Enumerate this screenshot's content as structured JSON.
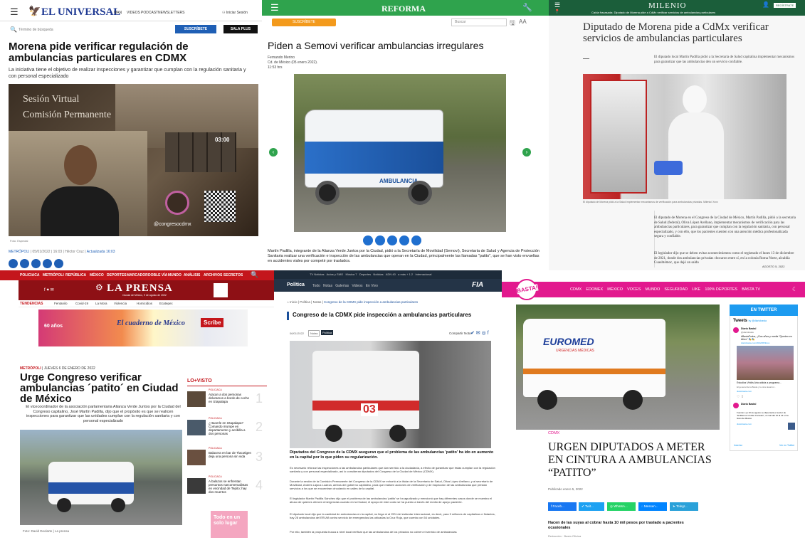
{
  "p1": {
    "logo": "EL UNIVERSAL",
    "nav": [
      "MAN",
      "VIDEOS",
      "PODCAST",
      "NEWSLETTERS"
    ],
    "login": "Iniciar Sesión",
    "search_placeholder": "Término de búsqueda",
    "subscribe": "SUSCRÍBETE",
    "sala": "SALA PLUS",
    "headline": "Morena pide verificar regulación de ambulancias particulares en CDMX",
    "subhead": "La iniciativa tiene el objetivo de realizar inspecciones y garantizar que cumplan con la regulación sanitaria y con personal especializado",
    "video_title1": "Sesión Virtual",
    "video_title2": "Comisión Permanente",
    "timer": "03:00",
    "handle": "@congresocdmx",
    "credit": "Foto: Especial",
    "meta_section": "METRÓPOLI",
    "meta_date": "05/01/2022",
    "meta_time": "16:03",
    "meta_author": "Héctor Cruz",
    "meta_updated": "Actualizada 16:03"
  },
  "p2": {
    "logo": "REFORMA",
    "subscribe": "SUSCRÍBETE",
    "search_placeholder": "Buscar",
    "headline": "Piden a Semovi verificar ambulancias irregulares",
    "author": "Fernando Merino",
    "dateline": "Cd. de México (05 enero 2022).",
    "time": "11:53 hrs",
    "ambulance_text": "AMBULANCIA",
    "body": "Martín Padilla, integrante de la Alianza Verde Juntos por la Ciudad, pidió a la Secretaría de Movilidad (Semovi), Secretaría de Salud y Agencia de Protección Sanitaria realizar una verificación e inspección de las ambulancias que operan en la Ciudad, principalmente las llamadas \"patito\", que se han visto envueltas en accidentes viales por competir por traslados."
  },
  "p3": {
    "logo": "MILENIO",
    "ticker": "Caída fracasada: Diputado de Morena pide a CdMx verificar servicios de ambulancias particulares",
    "subscribe": "REGÍSTRATE",
    "headline": "Diputado de Morena pide a CdMx verificar servicios de ambulancias particulares",
    "lede": "El diputado local Martín Padilla pidió a la Secretaría de Salud capitalina implementar mecanismos para garantizar que las ambulancias den un servicio confiable.",
    "caption": "El diputado de Morena pidió a la Salud implementar mecanismos de verificación para ambulancias privadas. Milenio/ Xxxx",
    "p1": "El diputado de Morena en el Congreso de la Ciudad de México, Martín Padilla, pidió a la secretaria de Salud (federal), Oliva López Arellano, implementar mecanismos de verificación para las ambulancias particulares, para garantizar que cumplan con la regulación sanitaria, con personal especializado, y con ello, que los pacientes cuenten con una atención médica profesionalizada segura y confiable.",
    "p2": "El legislador dijo que se deben evitar acontecimientos como el registrado el lunes 13 de diciembre de 2021, donde dos ambulancias privadas chocaron entre sí, en la colonia Roma Norte, alcaldía Cuauhtémoc, que dejó un saldo",
    "date": "AGOSTO 5, 2022"
  },
  "p4": {
    "nav": [
      "POLICIACA",
      "METRÓPOLI",
      "REPÚBLICA",
      "MÉXICO",
      "DEPORTES",
      "MARCADOR",
      "DOBLE VÍA",
      "MUNDO",
      "ANÁLISIS",
      "ARCHIVOS SECRETOS"
    ],
    "logo": "LA PRENSA",
    "logo_sub": "Ciudad de México, 9 de agosto de 2022",
    "trending_label": "TENDENCIAS",
    "trending": [
      "Fentanilo",
      "Covid-19",
      "La Mora",
      "Violencia",
      "Homicidios",
      "Ecatepec"
    ],
    "ad_text": "El cuaderno de México",
    "ad_years": "60 años",
    "ad_brand": "Scribe",
    "section": "METRÓPOLI",
    "date": "JUEVES 6 DE ENERO DE 2022",
    "headline": "Urge Congreso verificar ambulancias ´patito´ en Ciudad de México",
    "subhead": "El vicecoordinador de la asociación parlamentaria Alianza Verde Juntos por la Ciudad del Congreso capitalino, José Martín Padilla, dijo que el propósito es que se realicen inspecciones para garantizar que las unidades cumplan con la regulación sanitaria y con personal especializado",
    "credit": "Foto: David Deolarte | La prensa",
    "lovisto_title": "LO+VISTO",
    "lovisto": [
      {
        "tag": "POLICIACA",
        "text": "Atacan a dos personas deluramos a bordo de coche en Iztapalapa",
        "num": "1"
      },
      {
        "tag": "POLICIACA",
        "text": "¿Hacerle en Iztapalapa? Comando irrumpe en departamento y acribilla a dos personas",
        "num": "2"
      },
      {
        "tag": "POLICIACA",
        "text": "Balacera en bar de Tlacotlgen deja una persona sin vida",
        "num": "3"
      },
      {
        "tag": "POLICIACA",
        "text": "A balazos se enfrentan presuntos narcomenudistas en vecindad de Tepito; hay dos muertos",
        "num": "4"
      }
    ],
    "sidebar_ad": "Todo en un solo lugar"
  },
  "p5": {
    "nav": [
      "TV Noticias",
      "Autos y SMO",
      "Música 7",
      "Deportes",
      "Noticias",
      "ADN 40",
      "a más + 1.2",
      "Internacional"
    ],
    "section": "Política",
    "tabs": [
      "Todo",
      "Notas",
      "Galerías",
      "Videos",
      "En Vivo"
    ],
    "brand": "FIA",
    "breadcrumb": [
      "Inicio",
      "Política",
      "Notas",
      "Congreso de la CDMX pide inspección a ambulancias particulares"
    ],
    "headline": "Congreso de la CDMX pide inspección a ambulancias particulares",
    "date_meta": "06/01/2022",
    "tags": [
      "Notas",
      "Política"
    ],
    "share": "Compartir Nota",
    "ambulance_number": "03",
    "lede": "Diputados del Congreso de la CDMX aseguran que el problema de las ambulancias 'patito' ha ido en aumento en la capital por lo que piden su regularización.",
    "p1": "Es necesario reforzar las inspecciones a las ambulancias particulares que dan servicio a la ciudadanía, a efecto de garantizar que éstas cumplan con la regulación sanitaria y con personal especializado, así lo consideran diputados del Congreso de la Ciudad de México (CDMX).",
    "p2": "Durante la sesión de la Comisión Permanente del Congreso de la CDMX se exhortó a la titular de la Secretaría de Salud, Oliva López Arellano, y al secretario de Movilidad, Andrés Lajous Loaeza, ambos del gobierno capitalino, para que realicen acciones de verificación y de inspección de las ambulancias que prestan servicios a los que se encuentran circulando en calles de la capital.",
    "p3": "El legislador Martín Padilla Sánchez dijo que el problema de las ambulancias 'patito' se ha agudizado y mencionó que hay diferentes casos donde se muestra el abuso de quienes ofrecen emergencias cuando en la Ciudad, el apoyo de este costo se ha puesto a través del medio de apoyo paciente.",
    "p4": "El diputado local dijo que la cantidad de ambulancias en la capital, no llega ni al 25% del estándar internacional, es decir, para 9 millones de capitalinos e flotantes, hay 28 ambulancias del ERUM contra servicio de emergencias las ubicadas la Cruz Roja, que cuenta con 54 unidades.",
    "p5": "Por ello, también la propuesta busca a nivel local verificar que las ambulancias de los privados no cobren el servicio de ambulancias"
  },
  "p6": {
    "logo": "BASTA!",
    "nav": [
      "CDMX",
      "EDOMEX",
      "MÉXICO",
      "VOCES",
      "MUNDO",
      "SEGURIDAD",
      "LIKE",
      "100% DEPORTES",
      "BASTA TV"
    ],
    "twitter_title": "EN TWITTER",
    "tweets_label": "Tweets",
    "tweets_by": "by @diariobasta",
    "tweet1_user": "Diario Basta!",
    "tweet1_handle": "@diariobasta",
    "tweet1_text": "#BastaTodos, ¿Dos años y media \"Queden en Aforo\" 🎭🎭",
    "tweet1_link": "diariobasta.com/2022/08/fotos",
    "tweet2_text": "Estudios Viridis Aria adicta a programa...",
    "tweet2_sub": "El general de la Basta y la otra desarrol...",
    "tweet2_link": "diariobasta.com",
    "tweet3_text": "Fuentes: ya 10 de agosto se dispersará el sector de \"Enfilamos 13 días Conteles\", el cual del 10 al 14 en la Gran de México",
    "tweet3_link": "diariobasta.com",
    "twitter_embed": "Insertar",
    "twitter_view": "Ver en Twitter",
    "ambulance_brand": "EUROMED",
    "ambulance_sub": "URGENCIAS MÉDICAS",
    "section": "CDMX",
    "headline": "URGEN DIPUTADOS A METER EN CINTURA A AMBULANCIAS “PATITO”",
    "published": "Publicado enero 5, 2022",
    "share": [
      "Faceb...",
      "Twit...",
      "WhatsA...",
      "Messen...",
      "Telegr..."
    ],
    "lede": "Hacen de las suyas al cobrar hasta 10 mil pesos por traslado a pacientes ocasionales",
    "byline": "Redacción · Basta Oficina"
  }
}
